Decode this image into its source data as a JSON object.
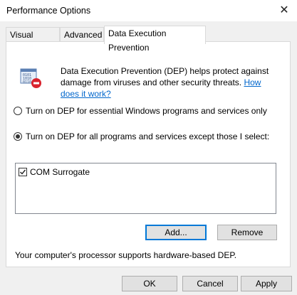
{
  "window": {
    "title": "Performance Options",
    "close_glyph": "✕"
  },
  "tabs": [
    {
      "label": "Visual Effects"
    },
    {
      "label": "Advanced"
    },
    {
      "label": "Data Execution Prevention",
      "active": true
    }
  ],
  "dep": {
    "description": "Data Execution Prevention (DEP) helps protect against damage from viruses and other security threats.",
    "link": "How does it work?",
    "icon": "dep-shield-icon"
  },
  "options": [
    {
      "label": "Turn on DEP for essential Windows programs and services only",
      "selected": false
    },
    {
      "label": "Turn on DEP for all programs and services except those I select:",
      "selected": true
    }
  ],
  "exceptions": [
    {
      "label": "COM Surrogate",
      "checked": true
    }
  ],
  "buttons": {
    "add": "Add...",
    "remove": "Remove"
  },
  "footer": "Your computer's processor supports hardware-based DEP.",
  "dialog_buttons": {
    "ok": "OK",
    "cancel": "Cancel",
    "apply": "Apply"
  },
  "colors": {
    "link": "#0066cc",
    "focus": "#0078d7"
  }
}
